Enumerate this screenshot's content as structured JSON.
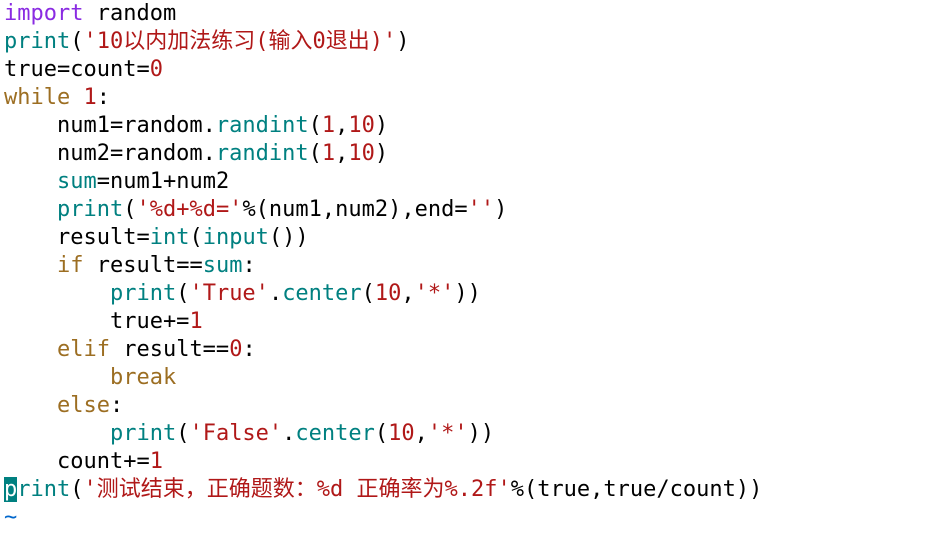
{
  "code": {
    "l1_import": "import",
    "l1_random": " random",
    "l2_print": "print",
    "l2_open": "(",
    "l2_str": "'10以内加法练习(输入0退出)'",
    "l2_close": ")",
    "l3": "true=count=",
    "l3_zero": "0",
    "l4_while": "while",
    "l4_sp": " ",
    "l4_one": "1",
    "l4_colon": ":",
    "l5_indent": "    num1=random.",
    "l5_randint": "randint",
    "l5_args_open": "(",
    "l5_a1": "1",
    "l5_comma": ",",
    "l5_a2": "10",
    "l5_args_close": ")",
    "l6_indent": "    num2=random.",
    "l6_randint": "randint",
    "l6_args_open": "(",
    "l6_a1": "1",
    "l6_comma": ",",
    "l6_a2": "10",
    "l6_args_close": ")",
    "l7_indent": "    ",
    "l7_sum": "sum",
    "l7_rest": "=num1+num2",
    "l8_indent": "    ",
    "l8_print": "print",
    "l8_open": "(",
    "l8_str": "'%d+%d='",
    "l8_mid": "%(num1,num2),end=",
    "l8_end": "''",
    "l8_close": ")",
    "l9_indent": "    result=",
    "l9_int": "int",
    "l9_open": "(",
    "l9_input": "input",
    "l9_close": "())",
    "l10_indent": "    ",
    "l10_if": "if",
    "l10_cond": " result==",
    "l10_sum": "sum",
    "l10_colon": ":",
    "l11_indent": "        ",
    "l11_print": "print",
    "l11_open": "(",
    "l11_str": "'True'",
    "l11_dot": ".",
    "l11_center": "center",
    "l11_args_open": "(",
    "l11_a1": "10",
    "l11_comma": ",",
    "l11_a2": "'*'",
    "l11_args_close": "))",
    "l12_indent": "        true+=",
    "l12_one": "1",
    "l13_indent": "    ",
    "l13_elif": "elif",
    "l13_cond": " result==",
    "l13_zero": "0",
    "l13_colon": ":",
    "l14_indent": "        ",
    "l14_break": "break",
    "l15_indent": "    ",
    "l15_else": "else",
    "l15_colon": ":",
    "l16_indent": "        ",
    "l16_print": "print",
    "l16_open": "(",
    "l16_str": "'False'",
    "l16_dot": ".",
    "l16_center": "center",
    "l16_args_open": "(",
    "l16_a1": "10",
    "l16_comma": ",",
    "l16_a2": "'*'",
    "l16_args_close": "))",
    "l17_indent": "    count+=",
    "l17_one": "1",
    "l18_p": "p",
    "l18_rint": "rint",
    "l18_open": "(",
    "l18_str": "'测试结束，正确题数：%d 正确率为%.2f'",
    "l18_rest": "%(true,true/count))",
    "l19_eof": "~"
  }
}
